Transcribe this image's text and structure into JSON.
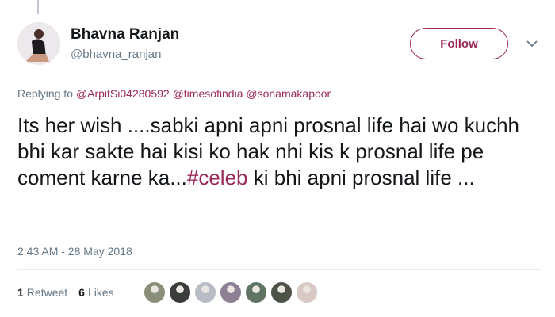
{
  "author": {
    "name": "Bhavna Ranjan",
    "handle": "@bhavna_ranjan"
  },
  "follow_label": "Follow",
  "reply": {
    "prefix": "Replying to",
    "mentions": [
      "@ArpitSi04280592",
      "@timesofindia",
      "@sonamakapoor"
    ]
  },
  "tweet": {
    "text_before": "Its her wish ....sabki apni apni prosnal life hai wo kuchh bhi kar sakte hai kisi ko hak nhi kis k prosnal life pe coment karne ka...",
    "hashtag": "#celeb",
    "text_after": " ki bhi apni prosnal life ..."
  },
  "timestamp": "2:43 AM - 28 May 2018",
  "stats": {
    "retweets_count": "1",
    "retweets_label": "Retweet",
    "likes_count": "6",
    "likes_label": "Likes"
  },
  "liker_avatars": [
    "#8a8f7a",
    "#3a3d3a",
    "#b8bcc4",
    "#8d7f94",
    "#5f7463",
    "#4d5247",
    "#d9c9c4"
  ],
  "colors": {
    "accent": "#9b2a5a",
    "secondary_text": "#657786",
    "divider": "#e6ecf0"
  }
}
